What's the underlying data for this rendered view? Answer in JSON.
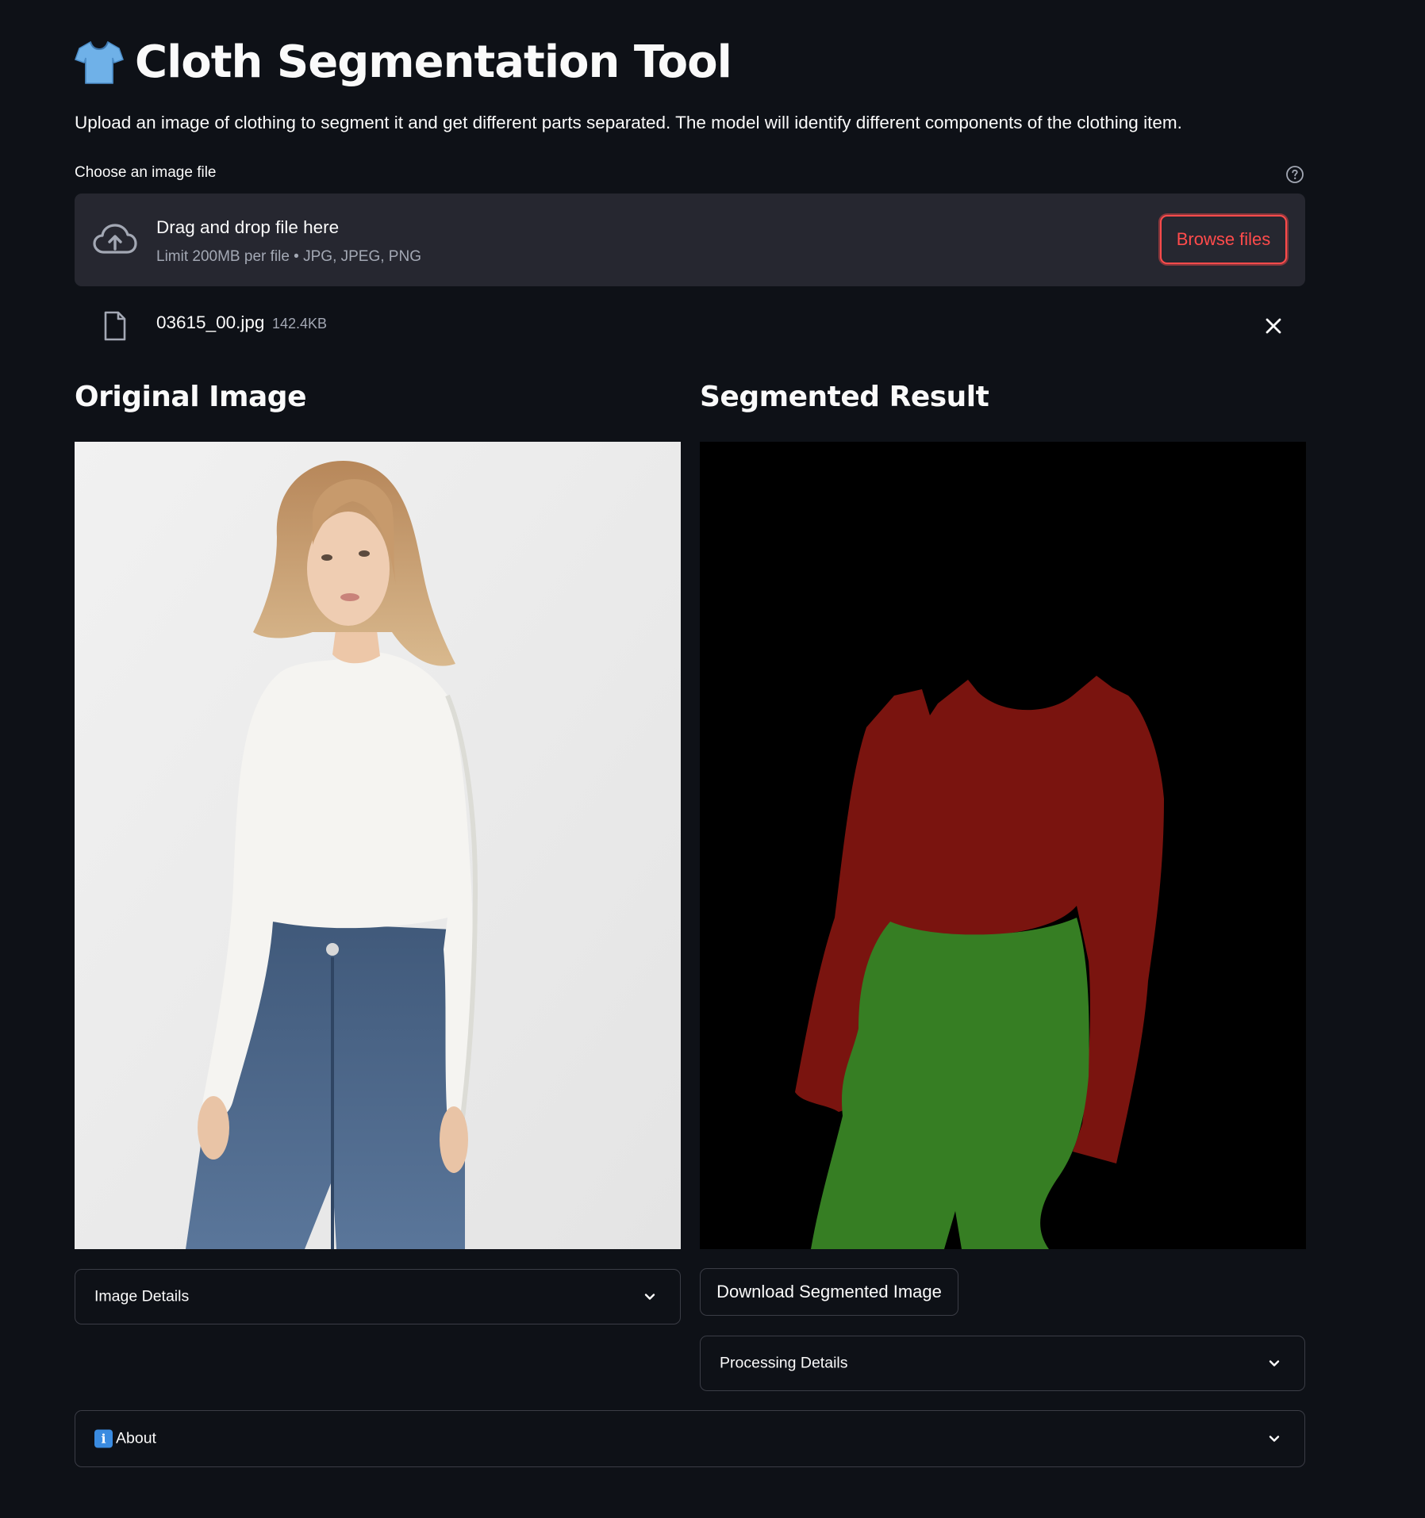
{
  "header": {
    "icon": "t-shirt-icon",
    "title": "Cloth Segmentation Tool",
    "description": "Upload an image of clothing to segment it and get different parts separated. The model will identify different components of the clothing item."
  },
  "uploader": {
    "label": "Choose an image file",
    "help_icon": "question-circle-icon",
    "drop_title": "Drag and drop file here",
    "drop_limit": "Limit 200MB per file • JPG, JPEG, PNG",
    "browse_label": "Browse files",
    "file": {
      "name": "03615_00.jpg",
      "size": "142.4KB"
    }
  },
  "left_column": {
    "heading": "Original Image",
    "expander_label": "Image Details"
  },
  "right_column": {
    "heading": "Segmented Result",
    "download_label": "Download Segmented Image",
    "expander_label": "Processing Details"
  },
  "about": {
    "emoji": "i",
    "label": "About"
  },
  "colors": {
    "background": "#0e1117",
    "panel": "#262730",
    "accent": "#ff4b4b",
    "seg_upper": "#7a140f",
    "seg_lower": "#367e23"
  }
}
